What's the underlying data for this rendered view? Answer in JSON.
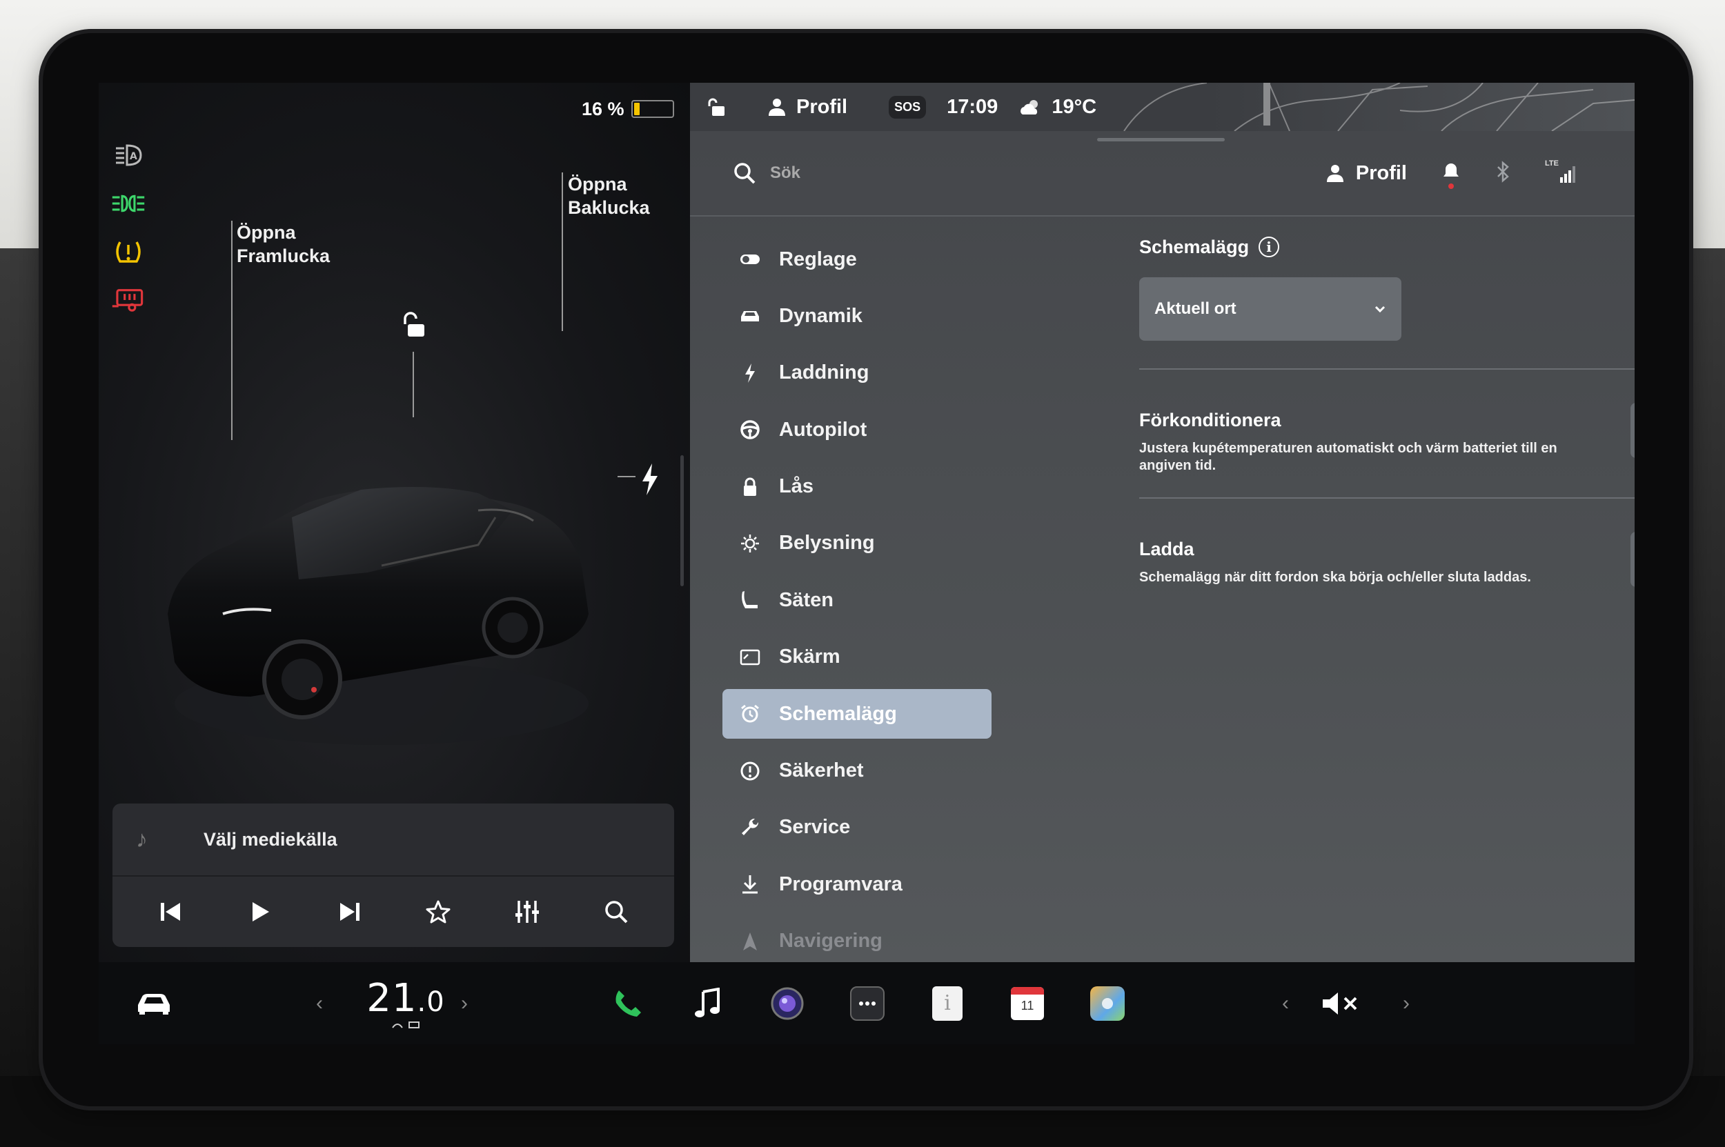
{
  "status": {
    "battery_percent": "16 %",
    "battery_level": 0.16,
    "profile": "Profil",
    "sos": "SOS",
    "time": "17:09",
    "weather_temp": "19°C"
  },
  "car": {
    "frunk_line1": "Öppna",
    "frunk_line2": "Framlucka",
    "trunk_line1": "Öppna",
    "trunk_line2": "Baklucka"
  },
  "media": {
    "title": "Välj mediekälla"
  },
  "search": {
    "placeholder": "Sök",
    "profile": "Profil",
    "lte": "LTE"
  },
  "nav": [
    {
      "label": "Reglage",
      "icon": "toggle-icon"
    },
    {
      "label": "Dynamik",
      "icon": "car-icon"
    },
    {
      "label": "Laddning",
      "icon": "bolt-icon"
    },
    {
      "label": "Autopilot",
      "icon": "steering-wheel-icon"
    },
    {
      "label": "Lås",
      "icon": "lock-icon"
    },
    {
      "label": "Belysning",
      "icon": "sun-icon"
    },
    {
      "label": "Säten",
      "icon": "seat-icon"
    },
    {
      "label": "Skärm",
      "icon": "display-icon"
    },
    {
      "label": "Schemalägg",
      "icon": "alarm-clock-icon",
      "active": true
    },
    {
      "label": "Säkerhet",
      "icon": "alert-circle-icon"
    },
    {
      "label": "Service",
      "icon": "wrench-icon"
    },
    {
      "label": "Programvara",
      "icon": "download-icon"
    },
    {
      "label": "Navigering",
      "icon": "navigation-icon"
    }
  ],
  "content": {
    "title": "Schemalägg",
    "location_select": "Aktuell ort",
    "preconditioning": {
      "title": "Förkonditionera",
      "desc": "Justera kupétemperaturen automatiskt och värm batteriet till en angiven tid."
    },
    "charge": {
      "title": "Ladda",
      "desc": "Schemalägg när ditt fordon ska börja och/eller sluta laddas."
    },
    "add_label": "+"
  },
  "bottom": {
    "temperature": "21",
    "temperature_decimal": ".0",
    "calendar_day": "11"
  },
  "colors": {
    "accent_active": "#aab7c8",
    "battery_fill": "#f5c400",
    "headlight_green": "#3dd66b",
    "warning_yellow": "#f5c400",
    "trailer_red": "#e0363b",
    "phone_green": "#2fc25b"
  }
}
